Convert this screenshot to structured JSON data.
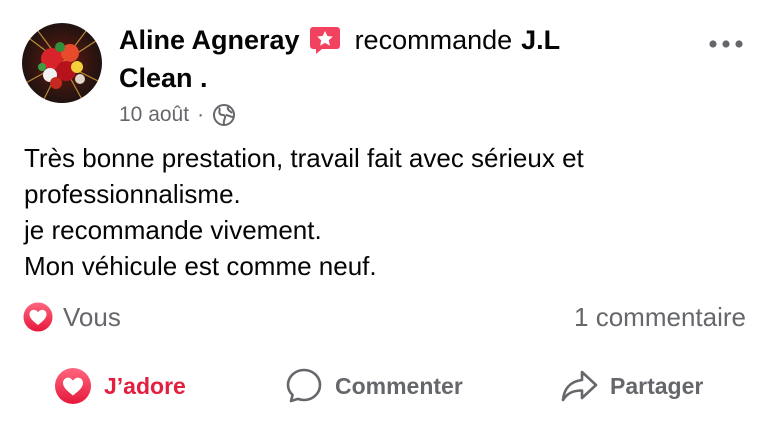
{
  "post": {
    "author": "Aline Agneray",
    "verb": "recommande",
    "page_name_line1": "J.L",
    "page_name_line2": "Clean .",
    "date": "10 août",
    "separator": "·",
    "privacy_icon": "globe-icon",
    "recommendation_icon": "star-badge-icon",
    "more_icon": "more-options-icon",
    "text_lines": [
      "Très bonne prestation, travail fait avec sérieux et",
      "professionnalisme.",
      "je recommande vivement.",
      "Mon véhicule est comme neuf."
    ]
  },
  "reactions": {
    "icon": "heart-reaction-icon",
    "who": "Vous",
    "comments": "1 commentaire"
  },
  "actions": {
    "love": "J’adore",
    "comment": "Commenter",
    "share": "Partager"
  },
  "colors": {
    "love_red": "#e41e3f",
    "secondary_text": "#65676b",
    "primary_text": "#050505",
    "badge_pink": "#f3425f"
  }
}
